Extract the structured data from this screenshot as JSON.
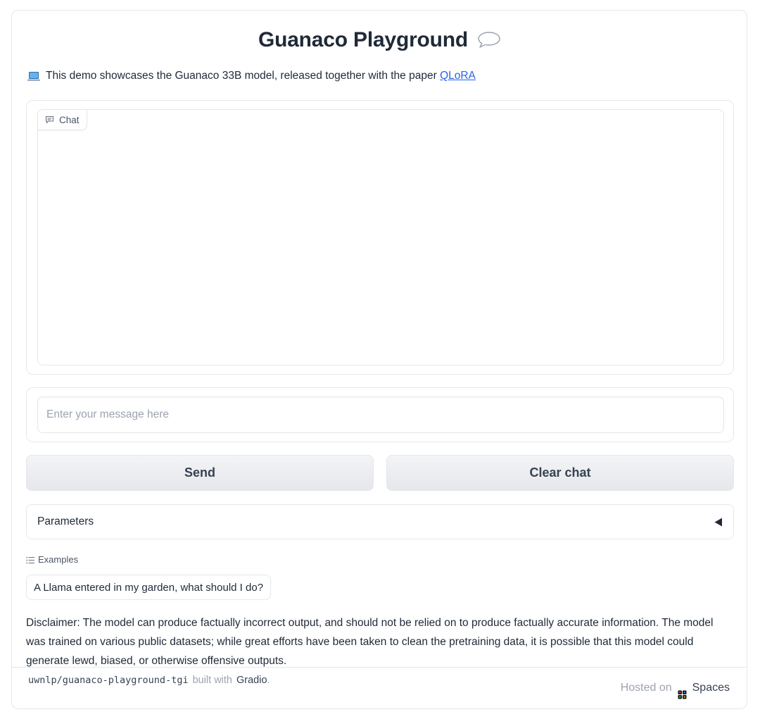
{
  "app": {
    "title": "Guanaco Playground",
    "title_icon": "speech-bubble-icon",
    "description_icon": "laptop-emoji-icon",
    "description_text": "This demo showcases the Guanaco 33B model, released together with the paper",
    "paper_link_label": "QLoRA"
  },
  "chat": {
    "label": "Chat",
    "label_icon": "chat-bubble-icon"
  },
  "input": {
    "value": "",
    "placeholder": "Enter your message here"
  },
  "buttons": {
    "send_label": "Send",
    "clear_label": "Clear chat"
  },
  "parameters": {
    "label": "Parameters",
    "toggle_icon": "triangle-left-icon"
  },
  "examples": {
    "label": "Examples",
    "icon": "list-icon",
    "items": [
      "A Llama entered in my garden, what should I do?"
    ]
  },
  "disclaimer": "Disclaimer: The model can produce factually incorrect output, and should not be relied on to produce factually accurate information. The model was trained on various public datasets; while great efforts have been taken to clean the pretraining data, it is possible that this model could generate lewd, biased, or otherwise offensive outputs.",
  "footer": {
    "space_id": "uwnlp/guanaco-playground-tgi",
    "built_with": "built with",
    "gradio_label": "Gradio",
    "period": ".",
    "hosted_on": "Hosted on",
    "spaces_label": "Spaces"
  },
  "colors": {
    "link": "#2563eb",
    "border": "#e5e7eb",
    "button_bg": "#e5e7eb",
    "muted_text": "#9ca3af"
  }
}
